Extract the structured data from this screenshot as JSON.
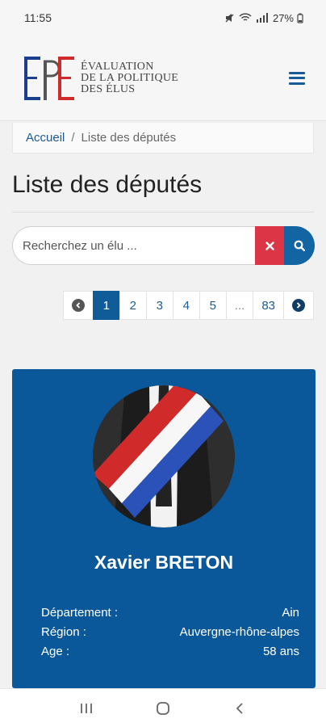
{
  "status_bar": {
    "time": "11:55",
    "battery": "27%"
  },
  "header": {
    "logo_lines": [
      "ÉVALUATION",
      "DE LA POLITIQUE",
      "DES ÉLUS"
    ],
    "logo_letters": "EPE"
  },
  "breadcrumb": {
    "home": "Accueil",
    "separator": "/",
    "current": "Liste des députés"
  },
  "page_title": "Liste des députés",
  "search": {
    "placeholder": "Recherchez un élu ..."
  },
  "pagination": {
    "pages": [
      "1",
      "2",
      "3",
      "4",
      "5",
      "...",
      "83"
    ],
    "active": "1"
  },
  "deputy": {
    "name": "Xavier BRETON",
    "fields": [
      {
        "label": "Département :",
        "value": "Ain"
      },
      {
        "label": "Région :",
        "value": "Auvergne-rhône-alpes"
      },
      {
        "label": "Age :",
        "value": "58 ans"
      }
    ]
  },
  "colors": {
    "primary": "#0a5899",
    "danger": "#dc3545",
    "background": "#f1f1f1"
  }
}
